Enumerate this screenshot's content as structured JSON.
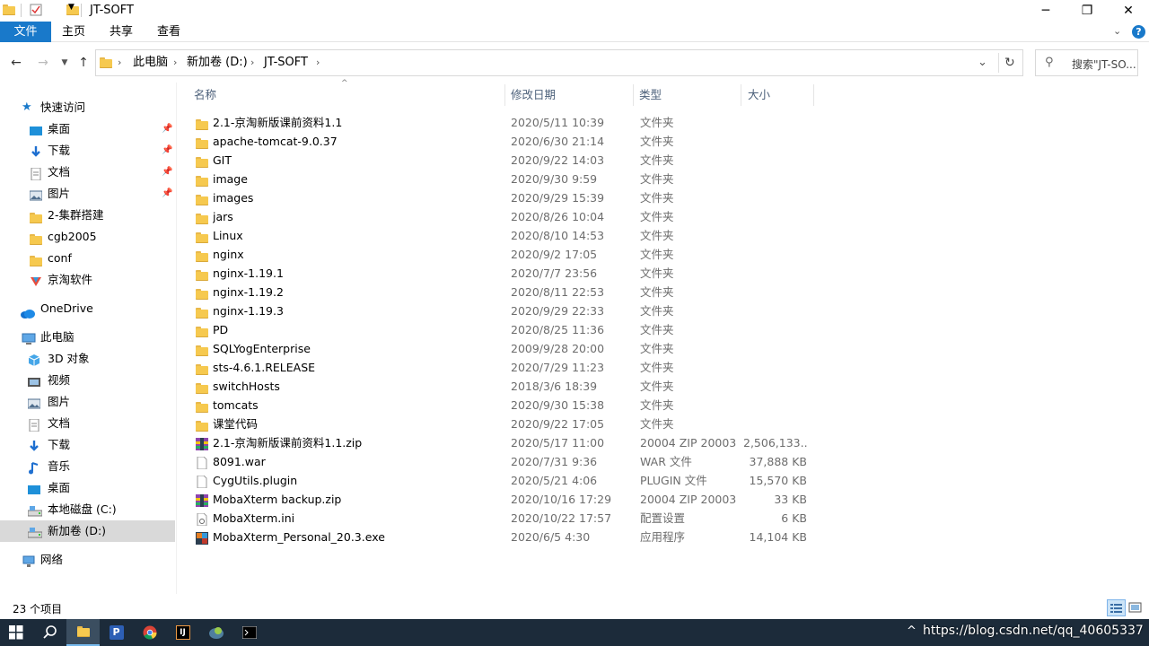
{
  "window": {
    "title": "JT-SOFT",
    "minimize": "─",
    "restore": "❐",
    "close": "✕"
  },
  "ribbon": {
    "tabs": [
      "文件",
      "主页",
      "共享",
      "查看"
    ]
  },
  "address": {
    "crumbs": [
      "此电脑",
      "新加卷 (D:)",
      "JT-SOFT"
    ],
    "search_placeholder": "搜索\"JT-SO..."
  },
  "nav": {
    "quick_access": "快速访问",
    "quick_items": [
      {
        "label": "桌面",
        "icon": "desktop-icon",
        "pinned": true
      },
      {
        "label": "下载",
        "icon": "download-icon",
        "pinned": true
      },
      {
        "label": "文档",
        "icon": "document-icon",
        "pinned": true
      },
      {
        "label": "图片",
        "icon": "picture-icon",
        "pinned": true
      },
      {
        "label": "2-集群搭建",
        "icon": "folder-icon",
        "pinned": false
      },
      {
        "label": "cgb2005",
        "icon": "folder-icon",
        "pinned": false
      },
      {
        "label": "conf",
        "icon": "folder-icon",
        "pinned": false
      },
      {
        "label": "京淘软件",
        "icon": "app-folder-icon",
        "pinned": false
      }
    ],
    "onedrive": "OneDrive",
    "this_pc": "此电脑",
    "pc_items": [
      {
        "label": "3D 对象",
        "icon": "3d-objects-icon"
      },
      {
        "label": "视频",
        "icon": "video-icon"
      },
      {
        "label": "图片",
        "icon": "picture-icon"
      },
      {
        "label": "文档",
        "icon": "document-icon"
      },
      {
        "label": "下载",
        "icon": "download-icon"
      },
      {
        "label": "音乐",
        "icon": "music-icon"
      },
      {
        "label": "桌面",
        "icon": "desktop-icon"
      },
      {
        "label": "本地磁盘 (C:)",
        "icon": "drive-icon"
      },
      {
        "label": "新加卷 (D:)",
        "icon": "drive-icon"
      }
    ],
    "network": "网络"
  },
  "columns": {
    "name": "名称",
    "date": "修改日期",
    "type": "类型",
    "size": "大小"
  },
  "files": [
    {
      "name": "2.1-京淘新版课前资料1.1",
      "date": "2020/5/11 10:39",
      "type": "文件夹",
      "size": "",
      "icon": "folder-icon"
    },
    {
      "name": "apache-tomcat-9.0.37",
      "date": "2020/6/30 21:14",
      "type": "文件夹",
      "size": "",
      "icon": "folder-icon"
    },
    {
      "name": "GIT",
      "date": "2020/9/22 14:03",
      "type": "文件夹",
      "size": "",
      "icon": "folder-icon"
    },
    {
      "name": "image",
      "date": "2020/9/30 9:59",
      "type": "文件夹",
      "size": "",
      "icon": "folder-icon"
    },
    {
      "name": "images",
      "date": "2020/9/29 15:39",
      "type": "文件夹",
      "size": "",
      "icon": "folder-icon"
    },
    {
      "name": "jars",
      "date": "2020/8/26 10:04",
      "type": "文件夹",
      "size": "",
      "icon": "folder-icon"
    },
    {
      "name": "Linux",
      "date": "2020/8/10 14:53",
      "type": "文件夹",
      "size": "",
      "icon": "folder-icon"
    },
    {
      "name": "nginx",
      "date": "2020/9/2 17:05",
      "type": "文件夹",
      "size": "",
      "icon": "folder-icon"
    },
    {
      "name": "nginx-1.19.1",
      "date": "2020/7/7 23:56",
      "type": "文件夹",
      "size": "",
      "icon": "folder-icon"
    },
    {
      "name": "nginx-1.19.2",
      "date": "2020/8/11 22:53",
      "type": "文件夹",
      "size": "",
      "icon": "folder-icon"
    },
    {
      "name": "nginx-1.19.3",
      "date": "2020/9/29 22:33",
      "type": "文件夹",
      "size": "",
      "icon": "folder-icon"
    },
    {
      "name": "PD",
      "date": "2020/8/25 11:36",
      "type": "文件夹",
      "size": "",
      "icon": "folder-icon"
    },
    {
      "name": "SQLYogEnterprise",
      "date": "2009/9/28 20:00",
      "type": "文件夹",
      "size": "",
      "icon": "folder-icon"
    },
    {
      "name": "sts-4.6.1.RELEASE",
      "date": "2020/7/29 11:23",
      "type": "文件夹",
      "size": "",
      "icon": "folder-icon"
    },
    {
      "name": "switchHosts",
      "date": "2018/3/6 18:39",
      "type": "文件夹",
      "size": "",
      "icon": "folder-icon"
    },
    {
      "name": "tomcats",
      "date": "2020/9/30 15:38",
      "type": "文件夹",
      "size": "",
      "icon": "folder-icon"
    },
    {
      "name": "课堂代码",
      "date": "2020/9/22 17:05",
      "type": "文件夹",
      "size": "",
      "icon": "folder-icon"
    },
    {
      "name": "2.1-京淘新版课前资料1.1.zip",
      "date": "2020/5/17 11:00",
      "type": "20004 ZIP 20003",
      "size": "2,506,133...",
      "icon": "archive-icon"
    },
    {
      "name": "8091.war",
      "date": "2020/7/31 9:36",
      "type": "WAR 文件",
      "size": "37,888 KB",
      "icon": "file-icon"
    },
    {
      "name": "CygUtils.plugin",
      "date": "2020/5/21 4:06",
      "type": "PLUGIN 文件",
      "size": "15,570 KB",
      "icon": "file-icon"
    },
    {
      "name": "MobaXterm backup.zip",
      "date": "2020/10/16 17:29",
      "type": "20004 ZIP 20003",
      "size": "33 KB",
      "icon": "archive-icon"
    },
    {
      "name": "MobaXterm.ini",
      "date": "2020/10/22 17:57",
      "type": "配置设置",
      "size": "6 KB",
      "icon": "settings-file-icon"
    },
    {
      "name": "MobaXterm_Personal_20.3.exe",
      "date": "2020/6/5 4:30",
      "type": "应用程序",
      "size": "14,104 KB",
      "icon": "exe-icon"
    }
  ],
  "status": {
    "count": "23 个项目"
  },
  "taskbar": {
    "watermark": "https://blog.csdn.net/qq_40605337"
  },
  "colors": {
    "accent": "#1979ca",
    "taskbar": "#1c2b3a",
    "folder": "#f6c94f",
    "selected": "#d9d9d9"
  }
}
